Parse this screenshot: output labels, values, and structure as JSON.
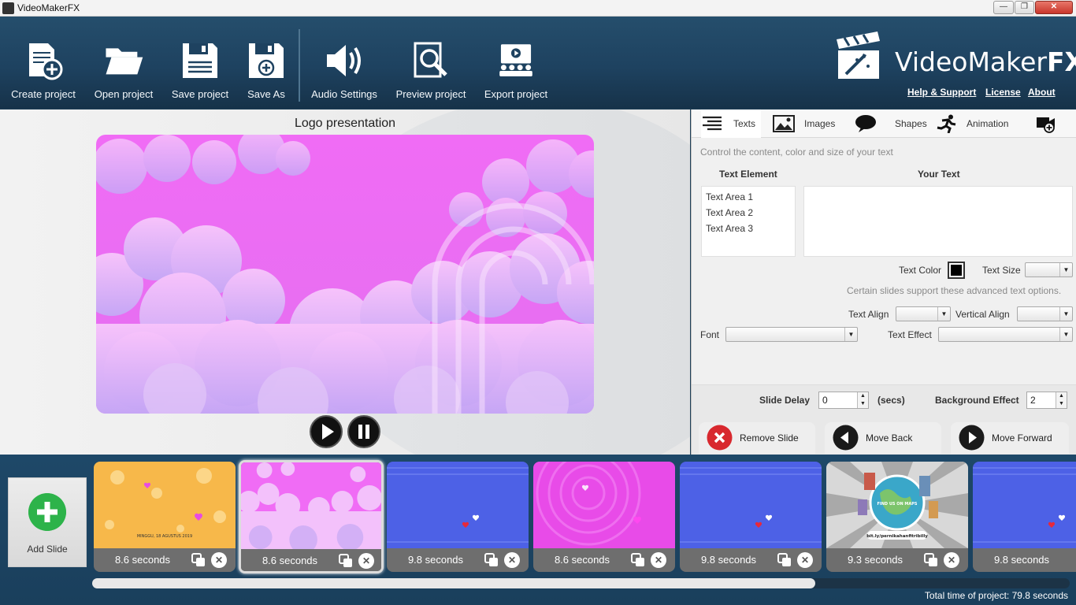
{
  "window": {
    "title": "VideoMakerFX",
    "minimize": "—",
    "maximize": "❐",
    "close": "✕"
  },
  "toolbar": {
    "create": "Create project",
    "open": "Open project",
    "save": "Save project",
    "save_as": "Save As",
    "audio": "Audio Settings",
    "preview": "Preview project",
    "export": "Export project"
  },
  "brand": {
    "name_light": "VideoMaker",
    "name_bold": "FX"
  },
  "links": {
    "help": "Help & Support",
    "license": "License",
    "about": "About"
  },
  "preview": {
    "title": "Logo presentation"
  },
  "panel": {
    "tabs": {
      "texts": "Texts",
      "images": "Images",
      "shapes": "Shapes",
      "animation": "Animation"
    },
    "description": "Control the content, color and size of your text",
    "col_element": "Text Element",
    "col_your_text": "Your Text",
    "elements": [
      "Text Area 1",
      "Text Area 2",
      "Text Area 3"
    ],
    "your_text": "",
    "text_color_label": "Text Color",
    "text_size_label": "Text Size",
    "advanced_note": "Certain slides support these advanced text options.",
    "text_align_label": "Text Align",
    "vertical_align_label": "Vertical Align",
    "font_label": "Font",
    "text_effect_label": "Text Effect",
    "slide_delay_label": "Slide Delay",
    "slide_delay_value": "0",
    "secs_label": "(secs)",
    "background_effect_label": "Background Effect",
    "background_effect_value": "2",
    "remove_slide": "Remove Slide",
    "move_back": "Move Back",
    "move_forward": "Move Forward"
  },
  "timeline": {
    "add_slide": "Add Slide",
    "slides": [
      {
        "duration": "8.6 seconds",
        "text1": "MINGGU, 18 AGUSTUS 2019"
      },
      {
        "duration": "8.6 seconds"
      },
      {
        "duration": "9.8 seconds"
      },
      {
        "duration": "8.6 seconds"
      },
      {
        "duration": "9.8 seconds"
      },
      {
        "duration": "9.3 seconds",
        "text1": "FIND US ON MAPS",
        "text2": "bit.ly/pernikahanfitribilly"
      },
      {
        "duration": "9.8 seconds"
      }
    ],
    "total_time": "Total time of project: 79.8 seconds",
    "scroll_fraction": 0.74
  },
  "colors": {
    "accent_green": "#2db34a",
    "remove_red": "#d8282e",
    "toolbar_blue": "#1e4260",
    "stage_pink": "#f06cf5"
  }
}
